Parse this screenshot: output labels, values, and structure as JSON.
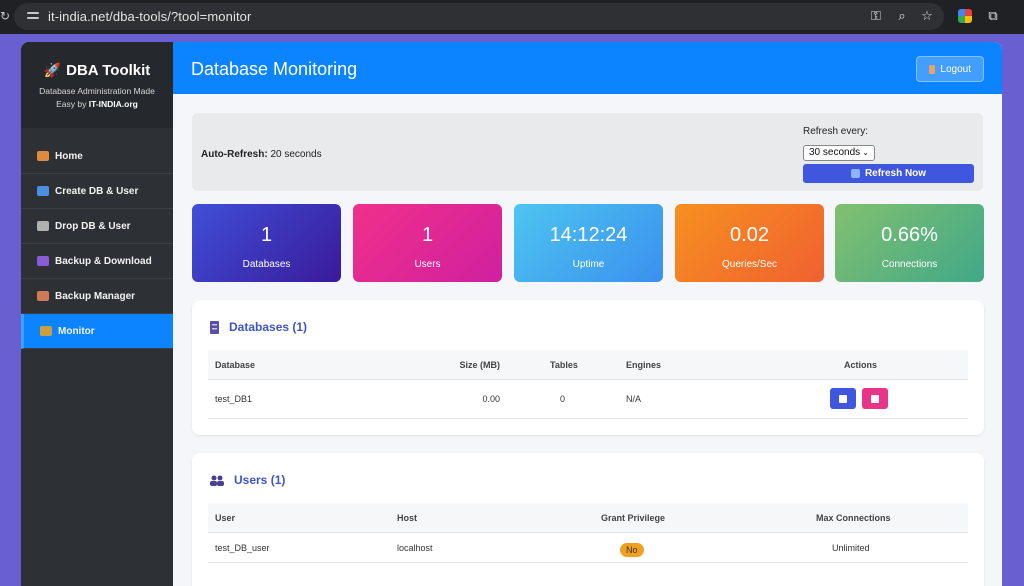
{
  "browser": {
    "url": "it-india.net/dba-tools/?tool=monitor"
  },
  "brand": {
    "title": "DBA Toolkit",
    "subtitle": "Database Administration Made Easy by ",
    "subtitle_strong": "IT-INDIA.org"
  },
  "sidebar": {
    "items": [
      {
        "label": "Home",
        "icon": "house-icon",
        "color": "#e08a3c"
      },
      {
        "label": "Create DB & User",
        "icon": "new-icon",
        "color": "#4a8fe0"
      },
      {
        "label": "Drop DB & User",
        "icon": "trash-icon",
        "color": "#b0b0b0"
      },
      {
        "label": "Backup & Download",
        "icon": "floppy-icon",
        "color": "#8a5cd8"
      },
      {
        "label": "Backup Manager",
        "icon": "person-icon",
        "color": "#d07a5c"
      },
      {
        "label": "Monitor",
        "icon": "chart-icon",
        "color": "#c8a040"
      }
    ]
  },
  "header": {
    "title": "Database Monitoring",
    "logout_label": "Logout"
  },
  "refresh": {
    "auto_label": "Auto-Refresh:",
    "auto_value": "20 seconds",
    "every_label": "Refresh every:",
    "selected_option": "30 seconds",
    "button_label": "Refresh Now"
  },
  "stats": [
    {
      "value": "1",
      "label": "Databases",
      "from": "#3f4fd8",
      "to": "#3a1a9a"
    },
    {
      "value": "1",
      "label": "Users",
      "from": "#f0308a",
      "to": "#d020a0"
    },
    {
      "value": "14:12:24",
      "label": "Uptime",
      "from": "#4ec5f0",
      "to": "#3a90ee"
    },
    {
      "value": "0.02",
      "label": "Queries/Sec",
      "from": "#f79020",
      "to": "#f06030"
    },
    {
      "value": "0.66%",
      "label": "Connections",
      "from": "#82c070",
      "to": "#40a888"
    }
  ],
  "databases": {
    "title": "Databases (1)",
    "columns": [
      "Database",
      "Size (MB)",
      "Tables",
      "Engines",
      "Actions"
    ],
    "rows": [
      {
        "name": "test_DB1",
        "size": "0.00",
        "tables": "0",
        "engines": "N/A"
      }
    ]
  },
  "users": {
    "title": "Users (1)",
    "columns": [
      "User",
      "Host",
      "Grant Privilege",
      "Max Connections"
    ],
    "rows": [
      {
        "user": "test_DB_user",
        "host": "localhost",
        "grant": "No",
        "max": "Unlimited"
      }
    ]
  },
  "colors": {
    "primary": "#0d84ff",
    "sidebar": "#2d3136",
    "accent_blue": "#3f57de",
    "accent_pink": "#e8358a"
  }
}
